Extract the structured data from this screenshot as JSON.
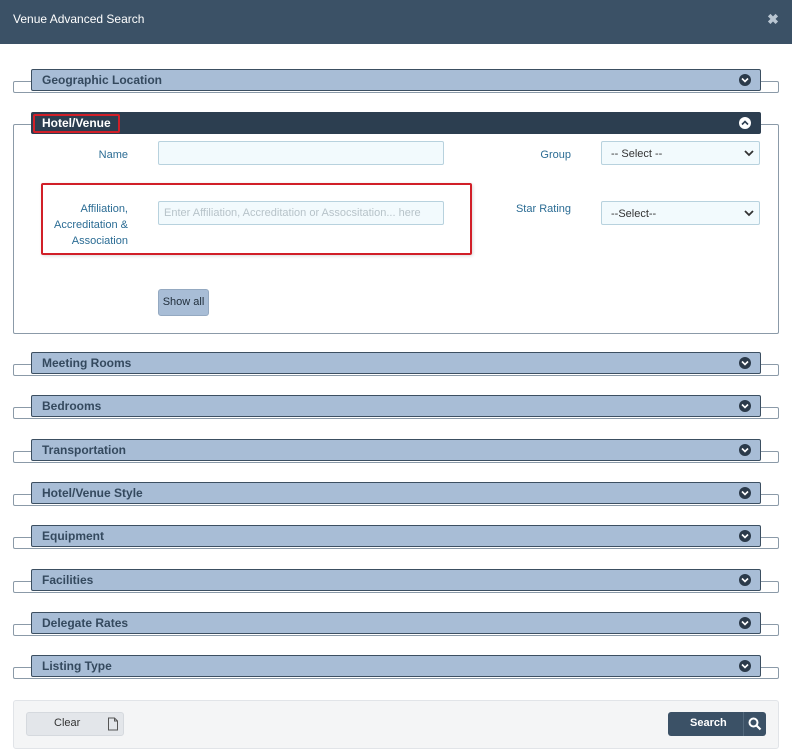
{
  "dialog": {
    "title": "Venue Advanced Search",
    "close_icon": "close-icon"
  },
  "sections": {
    "geographic": {
      "label": "Geographic Location"
    },
    "hotel": {
      "label": "Hotel/Venue"
    },
    "meeting_rooms": {
      "label": "Meeting Rooms"
    },
    "bedrooms": {
      "label": "Bedrooms"
    },
    "transportation": {
      "label": "Transportation"
    },
    "hotel_style": {
      "label": "Hotel/Venue Style"
    },
    "equipment": {
      "label": "Equipment"
    },
    "facilities": {
      "label": "Facilities"
    },
    "delegate_rates": {
      "label": "Delegate Rates"
    },
    "listing_type": {
      "label": "Listing Type"
    }
  },
  "hotel_form": {
    "name_label": "Name",
    "name_value": "",
    "group_label": "Group",
    "group_value": "-- Select --",
    "affiliation_label_1": "Affiliation,",
    "affiliation_label_2": "Accreditation &",
    "affiliation_label_3": "Association",
    "affiliation_placeholder": "Enter Affiliation, Accreditation or Assocsitation... here",
    "star_rating_label": "Star Rating",
    "star_rating_value": "--Select--",
    "show_all_label": "Show all"
  },
  "footer": {
    "clear_label": "Clear",
    "search_label": "Search"
  },
  "colors": {
    "titlebar": "#3b5166",
    "section_bar": "#a8bdd6",
    "section_bar_active": "#2c3e50",
    "label_blue": "#2b6c94",
    "highlight_red": "#d11f28"
  }
}
